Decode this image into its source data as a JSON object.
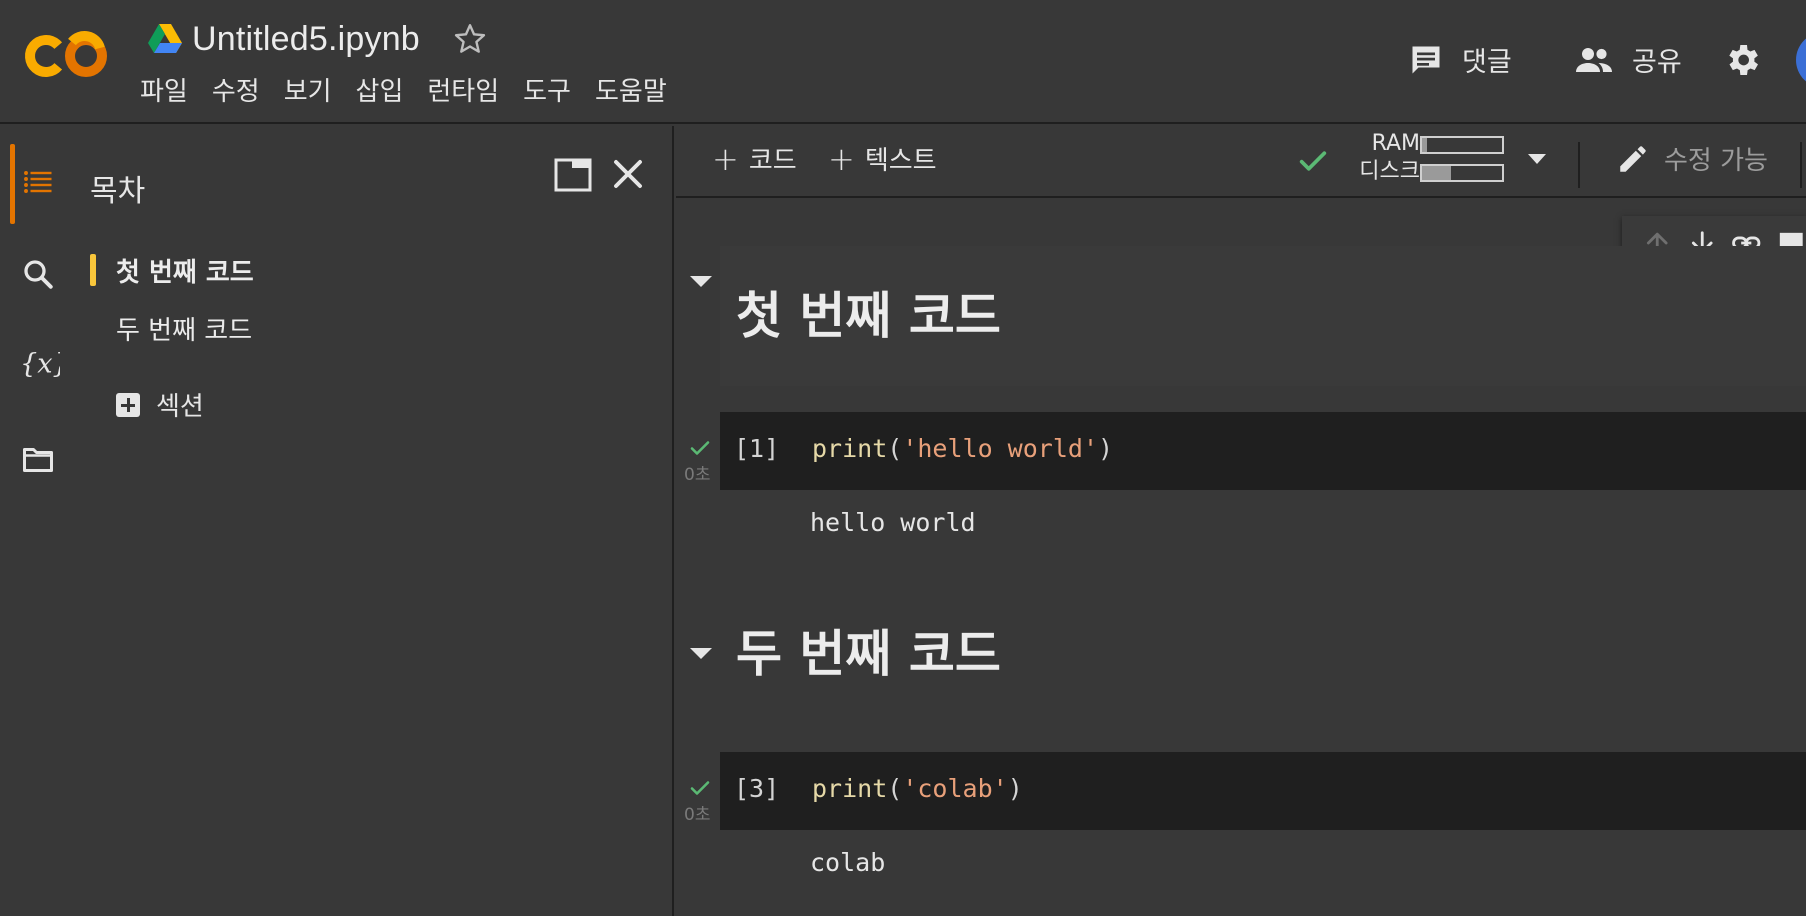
{
  "header": {
    "doc_title": "Untitled5.ipynb",
    "menu": [
      "파일",
      "수정",
      "보기",
      "삽입",
      "런타임",
      "도구",
      "도움말"
    ],
    "comment_label": "댓글",
    "share_label": "공유"
  },
  "sidebar": {
    "title": "목차",
    "toc": [
      "첫 번째 코드",
      "두 번째 코드"
    ],
    "add_section_label": "섹션"
  },
  "toolbar": {
    "add_code_label": "코드",
    "add_text_label": "텍스트",
    "ram_label": "RAM",
    "disk_label": "디스크",
    "ram_usage": 0.06,
    "disk_usage": 0.36,
    "edit_mode_label": "수정 가능"
  },
  "notebook": {
    "sections": [
      {
        "title": "첫 번째 코드"
      },
      {
        "title": "두 번째 코드"
      }
    ],
    "cells": [
      {
        "exec_count": "[1]",
        "fn": "print",
        "open": "(",
        "arg": "'hello world'",
        "close": ")",
        "output": "hello world",
        "run_time": "0초"
      },
      {
        "exec_count": "[3]",
        "fn": "print",
        "open": "(",
        "arg": "'colab'",
        "close": ")",
        "output": "colab",
        "run_time": "0초"
      }
    ]
  },
  "colors": {
    "logo_orange": "#e37400",
    "logo_yellow": "#f9ab00",
    "toc_marker": "#f9c63b",
    "success_green": "#5bb974",
    "string_color": "#e8a07a",
    "function_color": "#e6d9a8"
  }
}
